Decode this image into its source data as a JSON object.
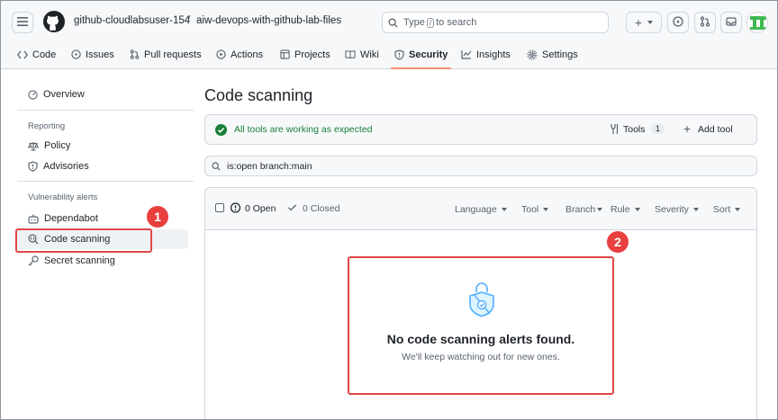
{
  "header": {
    "owner": "github-cloudlabsuser-154",
    "separator": "/",
    "repo": "aiw-devops-with-github-lab-files",
    "search": {
      "prefix": "Type",
      "key": "/",
      "suffix": "to search"
    }
  },
  "tabs": [
    {
      "label": "Code",
      "icon": "code-icon"
    },
    {
      "label": "Issues",
      "icon": "issue-icon"
    },
    {
      "label": "Pull requests",
      "icon": "pull-request-icon"
    },
    {
      "label": "Actions",
      "icon": "play-icon"
    },
    {
      "label": "Projects",
      "icon": "table-icon"
    },
    {
      "label": "Wiki",
      "icon": "book-icon"
    },
    {
      "label": "Security",
      "icon": "shield-icon",
      "active": true
    },
    {
      "label": "Insights",
      "icon": "graph-icon"
    },
    {
      "label": "Settings",
      "icon": "gear-icon"
    }
  ],
  "sidebar": {
    "overview": "Overview",
    "reporting_heading": "Reporting",
    "policy": "Policy",
    "advisories": "Advisories",
    "vuln_heading": "Vulnerability alerts",
    "dependabot": "Dependabot",
    "code_scanning": "Code scanning",
    "secret_scanning": "Secret scanning"
  },
  "main": {
    "title": "Code scanning",
    "status": "All tools are working as expected",
    "tools_label": "Tools",
    "tools_count": "1",
    "add_tool": "Add tool",
    "filter_value": "is:open branch:main",
    "open_label": "0 Open",
    "closed_label": "0 Closed",
    "filters": [
      "Language",
      "Tool",
      "Branch",
      "Rule",
      "Severity",
      "Sort"
    ],
    "empty_title": "No code scanning alerts found.",
    "empty_subtitle": "We'll keep watching out for new ones."
  },
  "annotations": {
    "step1": "1",
    "step2": "2"
  },
  "colors": {
    "accent_tab": "#fd8c73",
    "success": "#1a7f37",
    "annotation": "#e24646",
    "empty_icon": "#54aeff"
  }
}
